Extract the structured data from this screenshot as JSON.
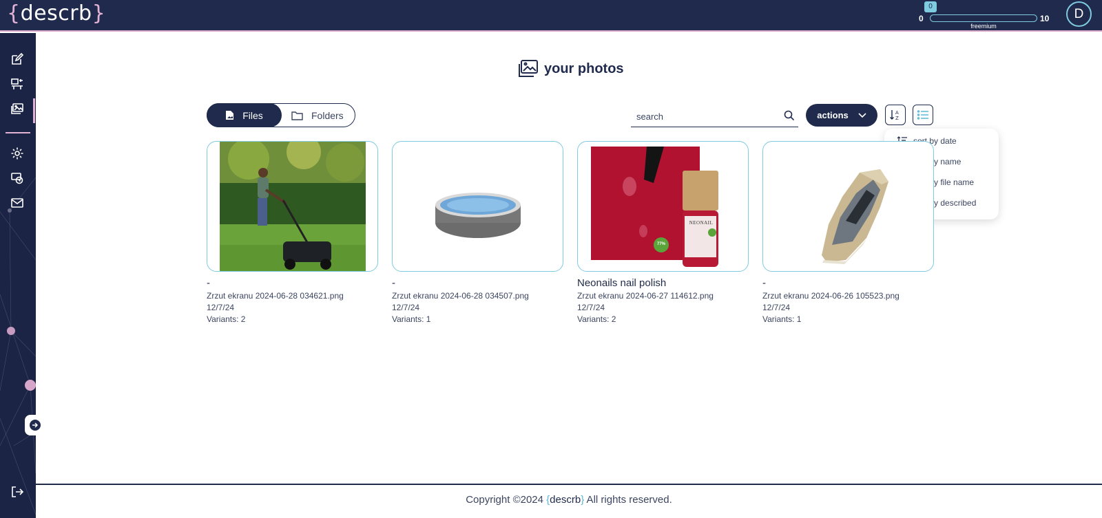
{
  "header": {
    "logo_open": "{",
    "logo_text": "descrb",
    "logo_close": "}",
    "quota_current": "0",
    "quota_min": "0",
    "quota_max": "10",
    "quota_progress": 0,
    "plan": "freemium",
    "avatar_initial": "D"
  },
  "sidebar": {
    "items": [
      {
        "icon": "edit-icon"
      },
      {
        "icon": "product-icon"
      },
      {
        "icon": "photos-icon",
        "active": true
      },
      {
        "icon": "settings-icon"
      },
      {
        "icon": "billing-icon"
      },
      {
        "icon": "mail-icon"
      }
    ],
    "expand_icon": "arrow-right-icon",
    "logout_icon": "logout-icon"
  },
  "page": {
    "title": "your photos"
  },
  "toolbar": {
    "files_label": "Files",
    "folders_label": "Folders",
    "search_placeholder": "search",
    "actions_label": "actions"
  },
  "sort_menu": [
    {
      "label": "sort by date"
    },
    {
      "label": "sort by name"
    },
    {
      "label": "sort by file name",
      "selected": true
    },
    {
      "label": "sort by described"
    }
  ],
  "cards": [
    {
      "name": "-",
      "file": "Zrzut ekranu 2024-06-28 034621.png",
      "date": "12/7/24",
      "variants": "Variants: 2"
    },
    {
      "name": "-",
      "file": "Zrzut ekranu 2024-06-28 034507.png",
      "date": "12/7/24",
      "variants": "Variants: 1"
    },
    {
      "name": "Neonails nail polish",
      "file": "Zrzut ekranu 2024-06-27 114612.png",
      "date": "12/7/24",
      "variants": "Variants: 2",
      "brand_text": "NEONAIL",
      "badge": "77%"
    },
    {
      "name": "-",
      "file": "Zrzut ekranu 2024-06-26 105523.png",
      "date": "12/7/24",
      "variants": "Variants: 1"
    }
  ],
  "footer": {
    "prefix": "Copyright ©2024 ",
    "brand_open": "{",
    "brand": "descrb",
    "brand_close": "}",
    "suffix": " All rights reserved."
  },
  "colors": {
    "navy": "#1f2a4c",
    "accent_pink": "#e3b3d6",
    "accent_cyan": "#7fcbe0"
  }
}
